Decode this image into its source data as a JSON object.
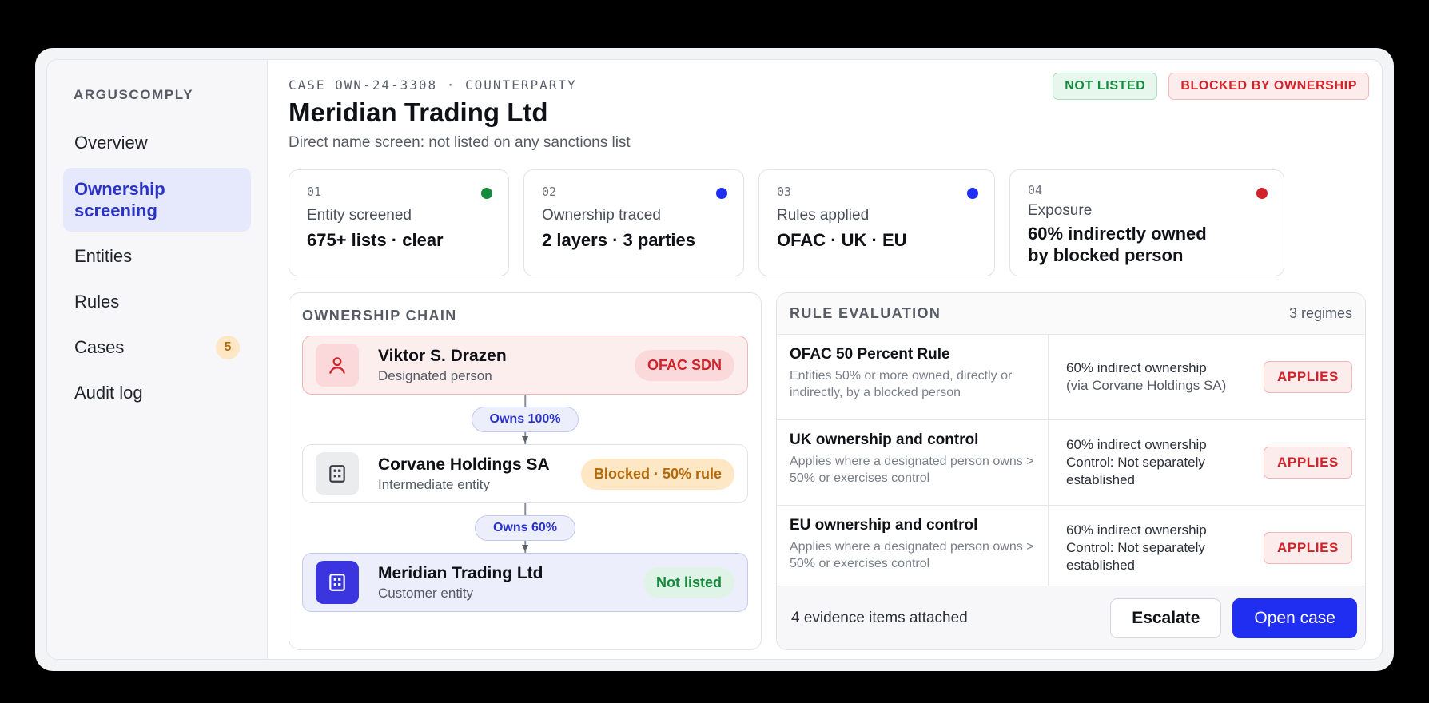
{
  "sidebar": {
    "brand": "ARGUSCOMPLY",
    "items": [
      {
        "label": "Overview"
      },
      {
        "label": "Ownership screening"
      },
      {
        "label": "Entities"
      },
      {
        "label": "Rules"
      },
      {
        "label": "Cases",
        "badge": "5"
      },
      {
        "label": "Audit log"
      }
    ]
  },
  "header": {
    "case_id": "CASE OWN-24-3308 · COUNTERPARTY",
    "title": "Meridian Trading Ltd",
    "subtitle": "Direct name screen: not listed on any sanctions list",
    "pills": [
      "NOT LISTED",
      "BLOCKED BY OWNERSHIP"
    ]
  },
  "steps": [
    {
      "num": "01",
      "label": "Entity screened",
      "value": "675+ lists · clear",
      "dot_color": "#168a3d"
    },
    {
      "num": "02",
      "label": "Ownership traced",
      "value": "2 layers · 3 parties",
      "dot_color": "#1f2ef0"
    },
    {
      "num": "03",
      "label": "Rules applied",
      "value": "OFAC · UK · EU",
      "dot_color": "#1f2ef0"
    },
    {
      "num": "04",
      "label": "Exposure",
      "value": "60% indirectly owned by blocked person",
      "dot_color": "#d0232a"
    }
  ],
  "chain": {
    "title": "OWNERSHIP CHAIN",
    "nodes": [
      {
        "name": "Viktor S. Drazen",
        "role": "Designated person",
        "tag": "OFAC SDN",
        "icon": "person-icon"
      },
      {
        "name": "Corvane Holdings SA",
        "role": "Intermediate entity",
        "tag": "Blocked · 50% rule",
        "icon": "building-icon"
      },
      {
        "name": "Meridian Trading Ltd",
        "role": "Customer entity",
        "tag": "Not listed",
        "icon": "building-icon"
      }
    ],
    "edges": [
      "Owns 100%",
      "Owns 60%"
    ]
  },
  "rules": {
    "title": "RULE EVALUATION",
    "count": "3 regimes",
    "rows": [
      {
        "name": "OFAC 50 Percent Rule",
        "desc": "Entities 50% or more owned, directly or indirectly, by a blocked person",
        "detail_1": "60% indirect ownership",
        "detail_2": "(via Corvane Holdings SA)",
        "result": "APPLIES"
      },
      {
        "name": "UK ownership and control",
        "desc": "Applies where a designated person owns > 50% or exercises control",
        "detail_1": "60% indirect ownership",
        "detail_2": "Control: Not separately established",
        "result": "APPLIES"
      },
      {
        "name": "EU ownership and control",
        "desc": "Applies where a designated person owns > 50% or exercises control",
        "detail_1": "60% indirect ownership",
        "detail_2": "Control: Not separately established",
        "result": "APPLIES"
      }
    ],
    "evidence": "4 evidence items attached",
    "escalate_label": "Escalate",
    "open_label": "Open case"
  }
}
